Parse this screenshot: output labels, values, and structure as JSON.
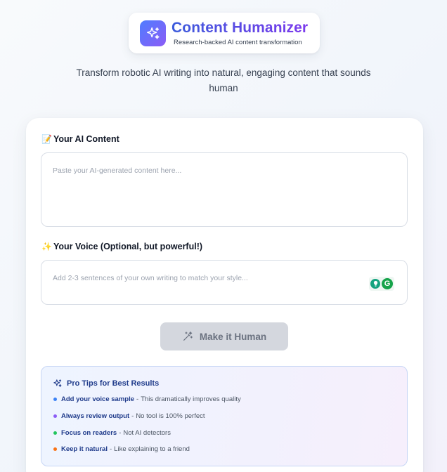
{
  "header": {
    "title": "Content Humanizer",
    "subtitle": "Research-backed AI content transformation",
    "logo_icon": "sparkles-icon",
    "colors": {
      "gradient_start": "#4f7dff",
      "gradient_end": "#8b5cf6"
    }
  },
  "tagline": "Transform robotic AI writing into natural, engaging content that sounds human",
  "form": {
    "ai_content": {
      "emoji": "📝",
      "label": "Your AI Content",
      "placeholder": "Paste your AI-generated content here...",
      "value": ""
    },
    "voice": {
      "emoji": "✨",
      "label": "Your Voice (Optional, but powerful!)",
      "placeholder": "Add 2-3 sentences of your own writing to match your style...",
      "value": "",
      "extension_icons": [
        "lightbulb-icon",
        "grammarly-icon"
      ],
      "grammarly_letter": "G"
    },
    "submit": {
      "label": "Make it Human",
      "icon": "magic-wand-icon",
      "disabled": true
    }
  },
  "tips": {
    "title": "Pro Tips for Best Results",
    "icon": "sparkles-icon",
    "separator": "-",
    "items": [
      {
        "strong": "Add your voice sample",
        "desc": "This dramatically improves quality",
        "color": "#3b82f6"
      },
      {
        "strong": "Always review output",
        "desc": "No tool is 100% perfect",
        "color": "#8b5cf6"
      },
      {
        "strong": "Focus on readers",
        "desc": "Not AI detectors",
        "color": "#22c55e"
      },
      {
        "strong": "Keep it natural",
        "desc": "Like explaining to a friend",
        "color": "#f97316"
      }
    ]
  }
}
